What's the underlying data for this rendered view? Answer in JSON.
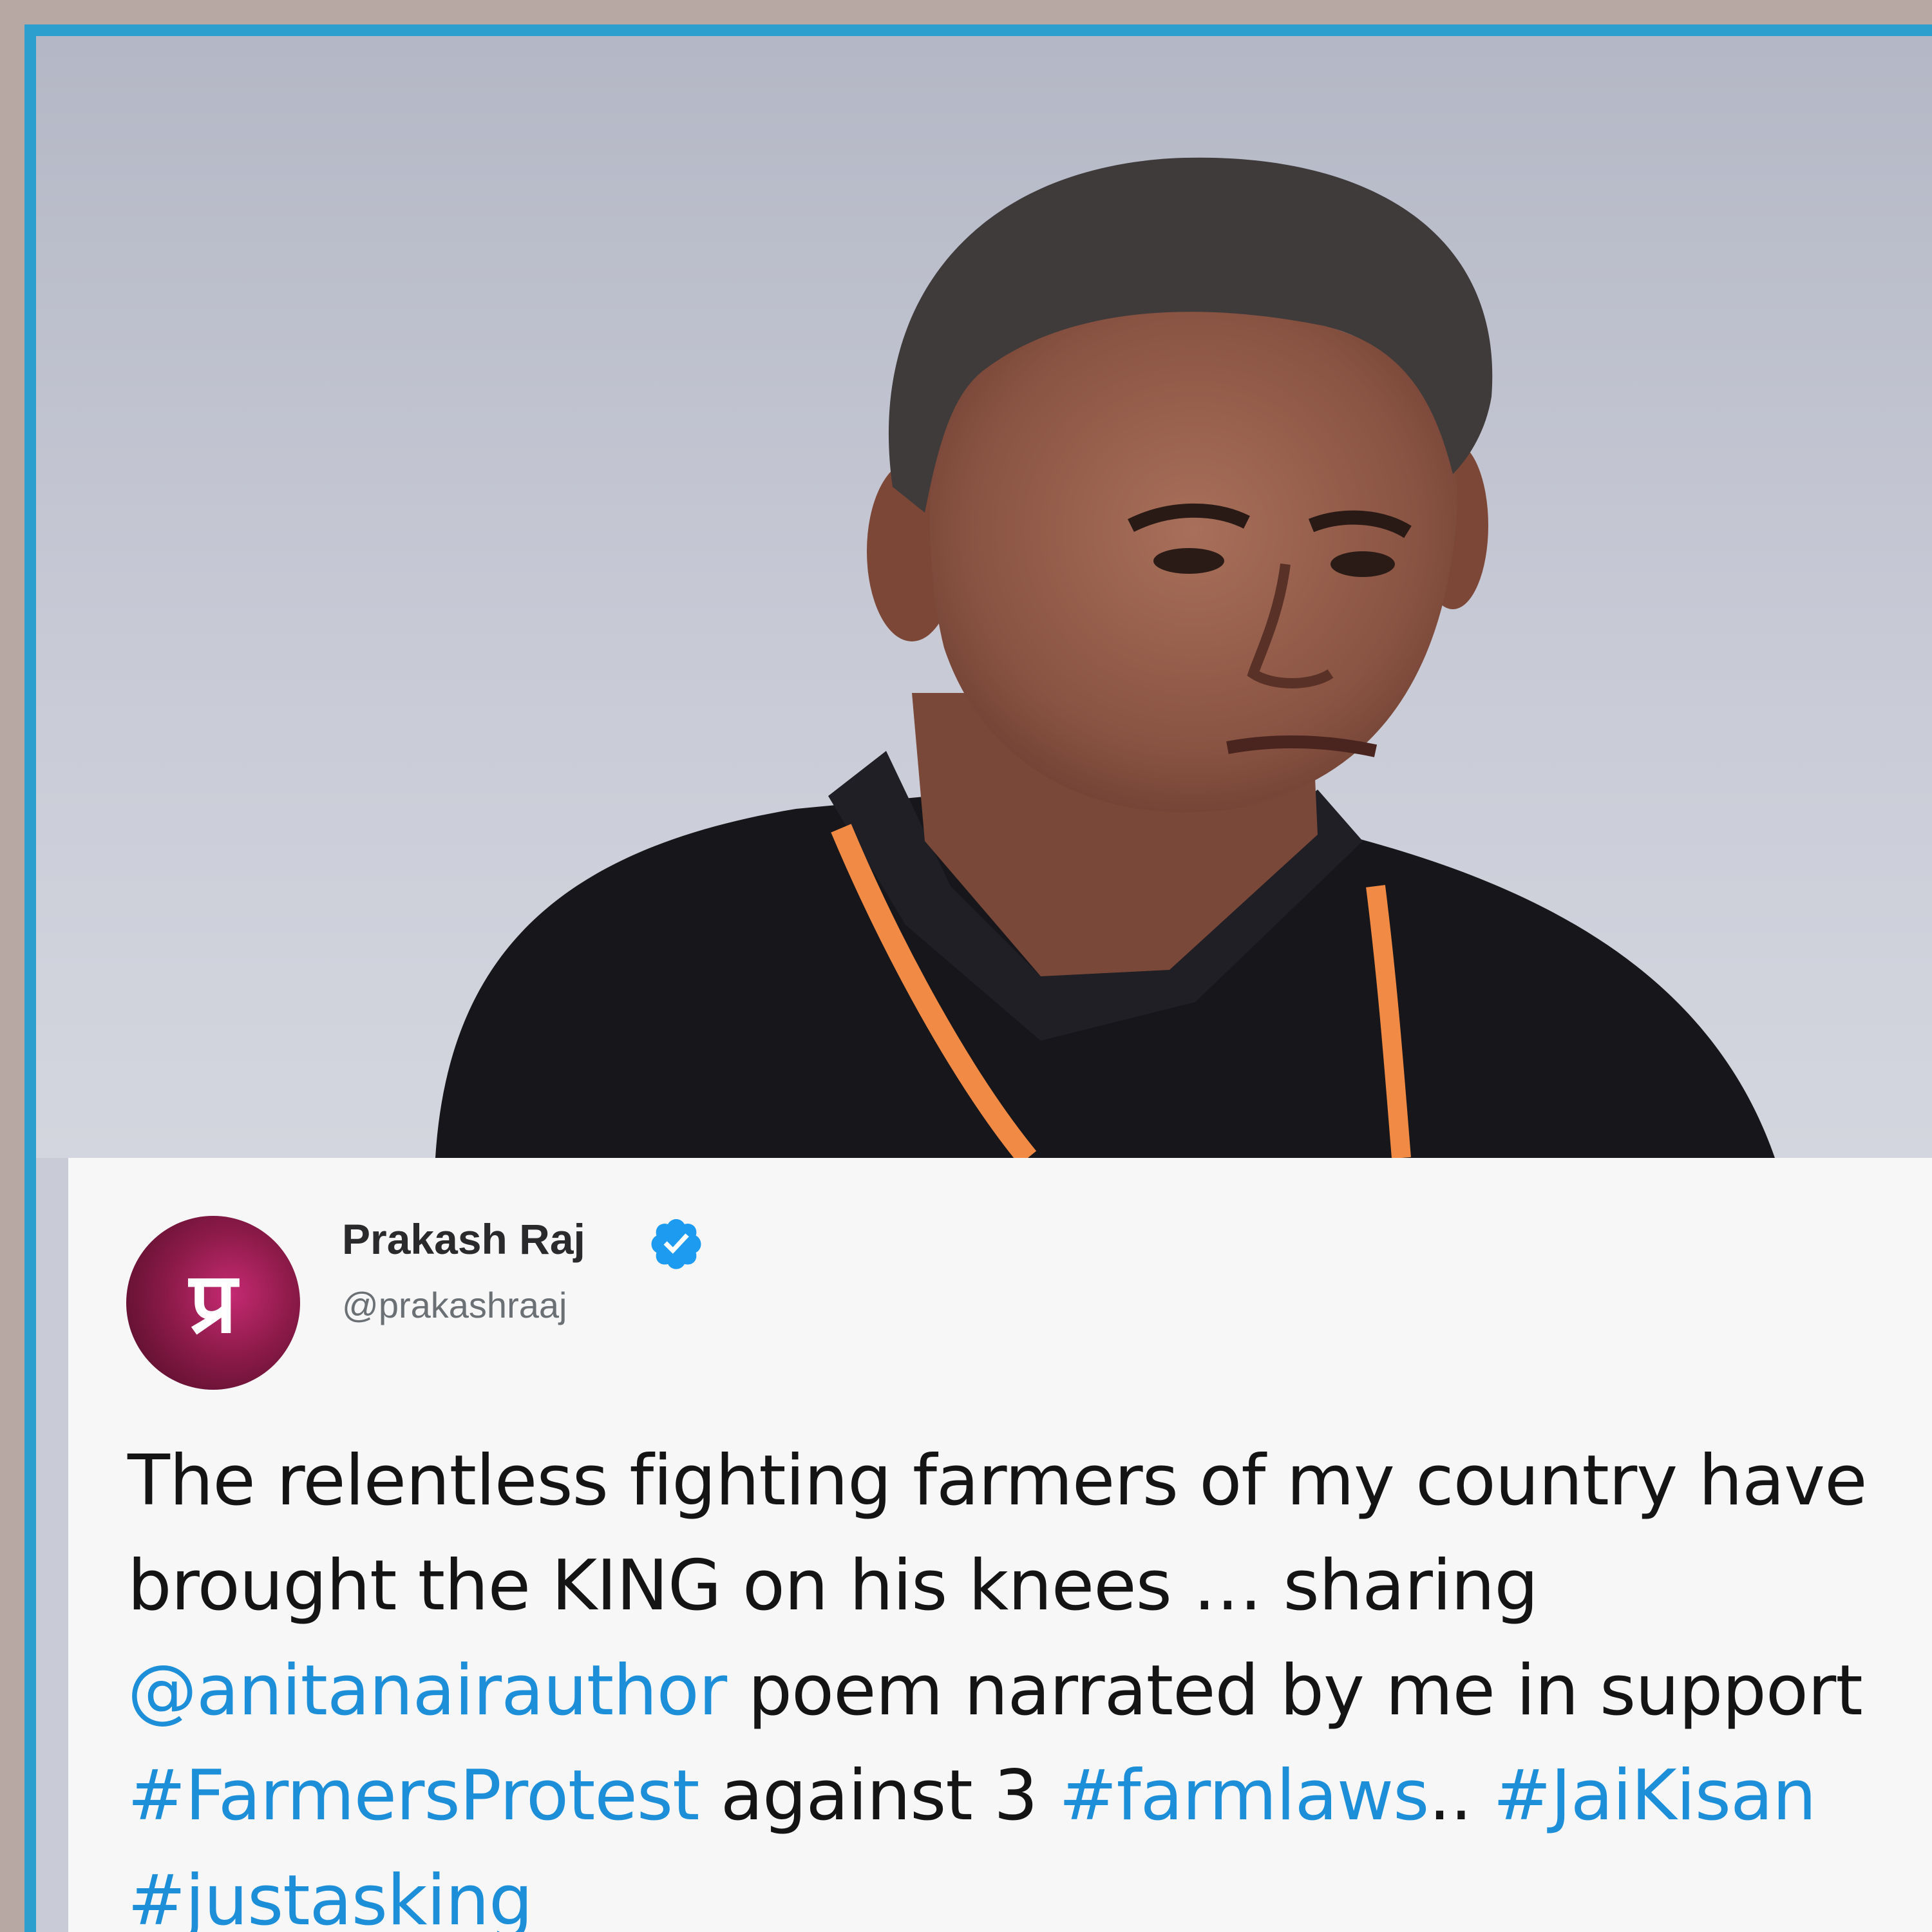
{
  "tweet": {
    "author_name": "Prakash Raj",
    "author_handle": "@prakashraaj",
    "avatar_glyph": "प्र",
    "verified": true,
    "segments": [
      {
        "text": "The relentless fighting farmers of my country have brought the KING on his knees … sharing ",
        "link": false
      },
      {
        "text": "@anitanairauthor",
        "link": true
      },
      {
        "text": " poem narrated by me in support ",
        "link": false
      },
      {
        "text": "#FarmersProtest",
        "link": true
      },
      {
        "text": " against 3 ",
        "link": false
      },
      {
        "text": "#farmlaws",
        "link": true
      },
      {
        "text": ".. ",
        "link": false
      },
      {
        "text": "#JaiKisan",
        "link": true
      },
      {
        "text": " ",
        "link": false
      },
      {
        "text": "#justasking",
        "link": true
      }
    ]
  },
  "colors": {
    "frame_border": "#2c9fcf",
    "link": "#1d8fd8",
    "verified_badge": "#1d9bf0",
    "card_background": "#f7f7f8"
  },
  "icons": {
    "verified": "verified-badge-icon"
  }
}
